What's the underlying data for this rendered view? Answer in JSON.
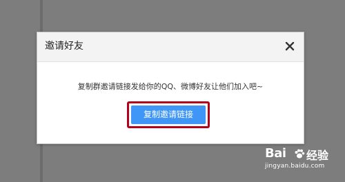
{
  "dialog": {
    "title": "邀请好友",
    "message": "复制群邀请链接发给你的QQ、微博好友让他们加入吧~",
    "copy_button_label": "复制邀请链接",
    "close_icon": "close-icon"
  },
  "watermark": {
    "brand": "Bai",
    "brand_suffix": "经验",
    "url": "jingyan.baidu.com"
  },
  "colors": {
    "background": "#7d7d7d",
    "primary_button": "#3f96f6",
    "highlight_border": "#b3001b"
  }
}
